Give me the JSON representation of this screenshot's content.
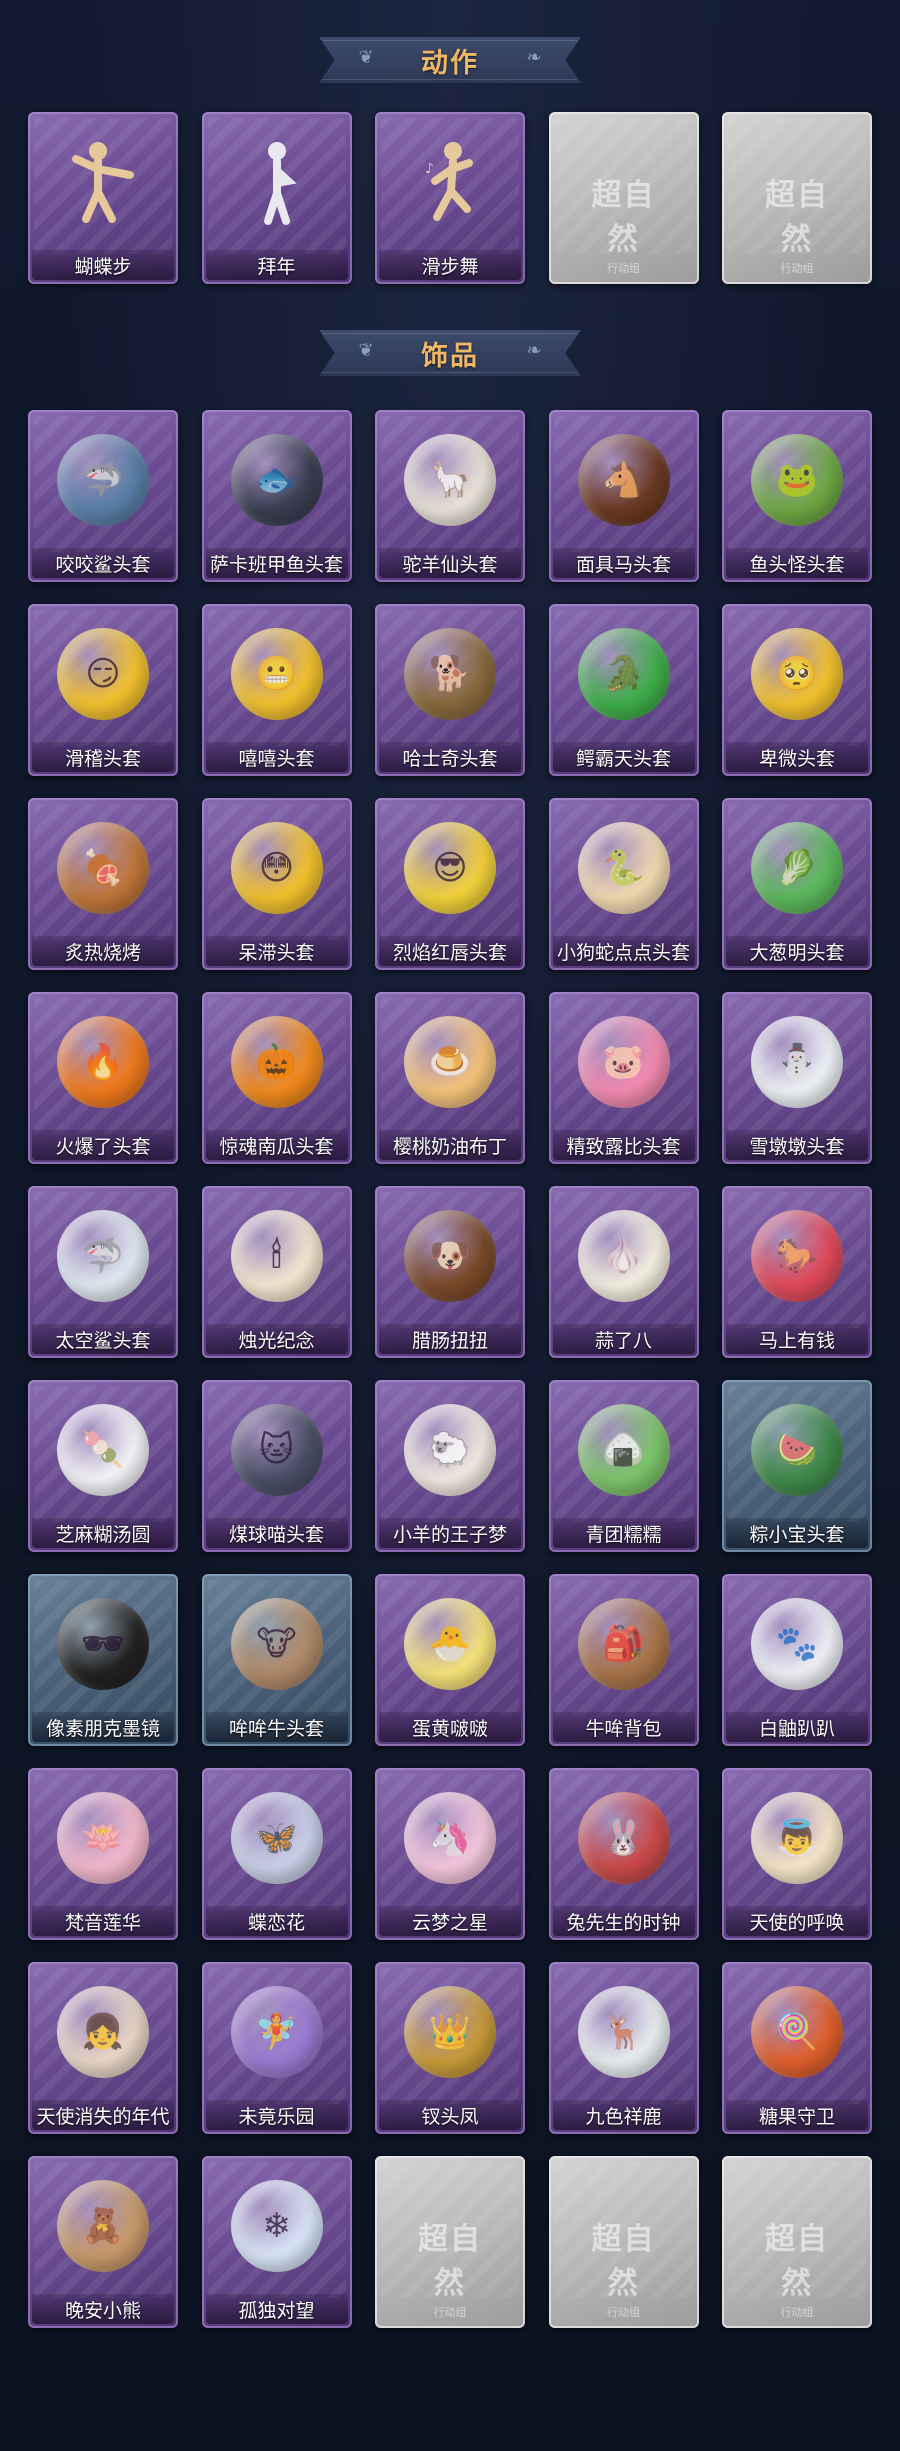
{
  "sections": [
    {
      "title": "动作"
    },
    {
      "title": "饰品"
    }
  ],
  "actions": [
    {
      "label": "蝴蝶步",
      "icon": "dance-pose-icon",
      "rarity": "purple"
    },
    {
      "label": "拜年",
      "icon": "bow-pose-icon",
      "rarity": "purple"
    },
    {
      "label": "滑步舞",
      "icon": "slide-dance-icon",
      "rarity": "purple"
    },
    {
      "label": "",
      "icon": "placeholder-watermark",
      "rarity": "grey",
      "watermark": "超自然",
      "watermark_sub": "行动组"
    },
    {
      "label": "",
      "icon": "placeholder-watermark",
      "rarity": "grey",
      "watermark": "超自然",
      "watermark_sub": "行动组"
    }
  ],
  "accessories": [
    {
      "label": "咬咬鲨头套",
      "icon": "shark-head-icon",
      "rarity": "purple",
      "color": "#5a7fa8",
      "glyph": "🦈"
    },
    {
      "label": "萨卡班甲鱼头套",
      "icon": "fish-head-icon",
      "rarity": "purple",
      "color": "#3a3f52",
      "glyph": "🐟"
    },
    {
      "label": "驼羊仙头套",
      "icon": "alpaca-head-icon",
      "rarity": "purple",
      "color": "#e9e2d8",
      "glyph": "🦙"
    },
    {
      "label": "面具马头套",
      "icon": "horse-head-icon",
      "rarity": "purple",
      "color": "#6b3a22",
      "glyph": "🐴"
    },
    {
      "label": "鱼头怪头套",
      "icon": "fish-monster-icon",
      "rarity": "purple",
      "color": "#6fa845",
      "glyph": "🐸"
    },
    {
      "label": "滑稽头套",
      "icon": "funny-face-icon",
      "rarity": "purple",
      "color": "#f2c12e",
      "glyph": "😏"
    },
    {
      "label": "嘻嘻头套",
      "icon": "grin-face-icon",
      "rarity": "purple",
      "color": "#f2c12e",
      "glyph": "😬"
    },
    {
      "label": "哈士奇头套",
      "icon": "husky-head-icon",
      "rarity": "purple",
      "color": "#8a6a3e",
      "glyph": "🐕"
    },
    {
      "label": "鳄霸天头套",
      "icon": "crocodile-head-icon",
      "rarity": "purple",
      "color": "#3fae4a",
      "glyph": "🐊"
    },
    {
      "label": "卑微头套",
      "icon": "humble-face-icon",
      "rarity": "purple",
      "color": "#f2c12e",
      "glyph": "🥺"
    },
    {
      "label": "炙热烧烤",
      "icon": "bbq-meat-icon",
      "rarity": "purple",
      "color": "#c0763a",
      "glyph": "🍖"
    },
    {
      "label": "呆滞头套",
      "icon": "dazed-face-icon",
      "rarity": "purple",
      "color": "#f2c12e",
      "glyph": "😳"
    },
    {
      "label": "烈焰红唇头套",
      "icon": "pikachu-head-icon",
      "rarity": "purple",
      "color": "#f3d23a",
      "glyph": "😎"
    },
    {
      "label": "小狗蛇点点头套",
      "icon": "snake-head-icon",
      "rarity": "purple",
      "color": "#f0d9b0",
      "glyph": "🐍"
    },
    {
      "label": "大葱明头套",
      "icon": "scallion-head-icon",
      "rarity": "purple",
      "color": "#5cb85c",
      "glyph": "🥬"
    },
    {
      "label": "火爆了头套",
      "icon": "fireball-head-icon",
      "rarity": "purple",
      "color": "#f07a1e",
      "glyph": "🔥"
    },
    {
      "label": "惊魂南瓜头套",
      "icon": "pumpkin-head-icon",
      "rarity": "purple",
      "color": "#f08a1e",
      "glyph": "🎃"
    },
    {
      "label": "樱桃奶油布丁",
      "icon": "pudding-icon",
      "rarity": "purple",
      "color": "#f3c27a",
      "glyph": "🍮"
    },
    {
      "label": "精致露比头套",
      "icon": "ruby-head-icon",
      "rarity": "purple",
      "color": "#f28ab0",
      "glyph": "🐷"
    },
    {
      "label": "雪墩墩头套",
      "icon": "snowman-head-icon",
      "rarity": "purple",
      "color": "#eef2f6",
      "glyph": "⛄"
    },
    {
      "label": "太空鲨头套",
      "icon": "space-shark-icon",
      "rarity": "purple",
      "color": "#dfe8f0",
      "glyph": "🦈"
    },
    {
      "label": "烛光纪念",
      "icon": "candle-icon",
      "rarity": "purple",
      "color": "#f3e6d0",
      "glyph": "🕯"
    },
    {
      "label": "腊肠扭扭",
      "icon": "dachshund-icon",
      "rarity": "purple",
      "color": "#7a4a2a",
      "glyph": "🐶"
    },
    {
      "label": "蒜了八",
      "icon": "garlic-icon",
      "rarity": "purple",
      "color": "#f3eee0",
      "glyph": "🧄"
    },
    {
      "label": "马上有钱",
      "icon": "money-horse-icon",
      "rarity": "purple",
      "color": "#e04a5a",
      "glyph": "🐎"
    },
    {
      "label": "芝麻糊汤圆",
      "icon": "tangyuan-icon",
      "rarity": "purple",
      "color": "#f4f4f8",
      "glyph": "🍡"
    },
    {
      "label": "煤球喵头套",
      "icon": "cat-head-icon",
      "rarity": "purple",
      "color": "#4a4f66",
      "glyph": "🐱"
    },
    {
      "label": "小羊的王子梦",
      "icon": "sheep-prince-icon",
      "rarity": "purple",
      "color": "#f0e8e0",
      "glyph": "🐑"
    },
    {
      "label": "青团糯糯",
      "icon": "qingtuan-icon",
      "rarity": "purple",
      "color": "#7cc46a",
      "glyph": "🍙"
    },
    {
      "label": "粽小宝头套",
      "icon": "zongzi-icon",
      "rarity": "blue",
      "color": "#3f8a4a",
      "glyph": "🍉"
    },
    {
      "label": "像素朋克墨镜",
      "icon": "pixel-sunglasses-icon",
      "rarity": "blue",
      "color": "#222222",
      "glyph": "🕶"
    },
    {
      "label": "哞哞牛头套",
      "icon": "cow-head-icon",
      "rarity": "blue",
      "color": "#b08a6a",
      "glyph": "🐮"
    },
    {
      "label": "蛋黄啵啵",
      "icon": "egg-chick-icon",
      "rarity": "purple",
      "color": "#f6e27a",
      "glyph": "🐣"
    },
    {
      "label": "牛哞背包",
      "icon": "cow-backpack-icon",
      "rarity": "purple",
      "color": "#a8744a",
      "glyph": "🎒"
    },
    {
      "label": "白鼬趴趴",
      "icon": "ermine-icon",
      "rarity": "purple",
      "color": "#eef0f6",
      "glyph": "🐾"
    },
    {
      "label": "梵音莲华",
      "icon": "lotus-fairy-icon",
      "rarity": "purple",
      "color": "#f2b8cc",
      "glyph": "🪷"
    },
    {
      "label": "蝶恋花",
      "icon": "butterfly-bell-icon",
      "rarity": "purple",
      "color": "#c9d0e8",
      "glyph": "🦋"
    },
    {
      "label": "云梦之星",
      "icon": "unicorn-cloud-icon",
      "rarity": "purple",
      "color": "#f4c6dc",
      "glyph": "🦄"
    },
    {
      "label": "兔先生的时钟",
      "icon": "rabbit-clock-icon",
      "rarity": "purple",
      "color": "#c94a4a",
      "glyph": "🐰"
    },
    {
      "label": "天使的呼唤",
      "icon": "angel-icon",
      "rarity": "purple",
      "color": "#f6e6c8",
      "glyph": "👼"
    },
    {
      "label": "天使消失的年代",
      "icon": "angel-girl-icon",
      "rarity": "purple",
      "color": "#e8d6c6",
      "glyph": "👧"
    },
    {
      "label": "未竟乐园",
      "icon": "paradise-girl-icon",
      "rarity": "purple",
      "color": "#9a7ad0",
      "glyph": "🧚"
    },
    {
      "label": "钗头凤",
      "icon": "phoenix-hairpin-icon",
      "rarity": "purple",
      "color": "#c89a3a",
      "glyph": "👑"
    },
    {
      "label": "九色祥鹿",
      "icon": "nine-color-deer-icon",
      "rarity": "purple",
      "color": "#e8eef0",
      "glyph": "🦌"
    },
    {
      "label": "糖果守卫",
      "icon": "candy-guard-icon",
      "rarity": "purple",
      "color": "#e0602e",
      "glyph": "🍭"
    },
    {
      "label": "晚安小熊",
      "icon": "goodnight-bear-icon",
      "rarity": "purple",
      "color": "#c89a6a",
      "glyph": "🧸"
    },
    {
      "label": "孤独对望",
      "icon": "lonely-gaze-icon",
      "rarity": "purple",
      "color": "#d8e4f6",
      "glyph": "❄"
    },
    {
      "label": "",
      "icon": "placeholder-watermark",
      "rarity": "grey",
      "watermark": "超自然",
      "watermark_sub": "行动组"
    },
    {
      "label": "",
      "icon": "placeholder-watermark",
      "rarity": "grey",
      "watermark": "超自然",
      "watermark_sub": "行动组"
    },
    {
      "label": "",
      "icon": "placeholder-watermark",
      "rarity": "grey",
      "watermark": "超自然",
      "watermark_sub": "行动组"
    }
  ]
}
